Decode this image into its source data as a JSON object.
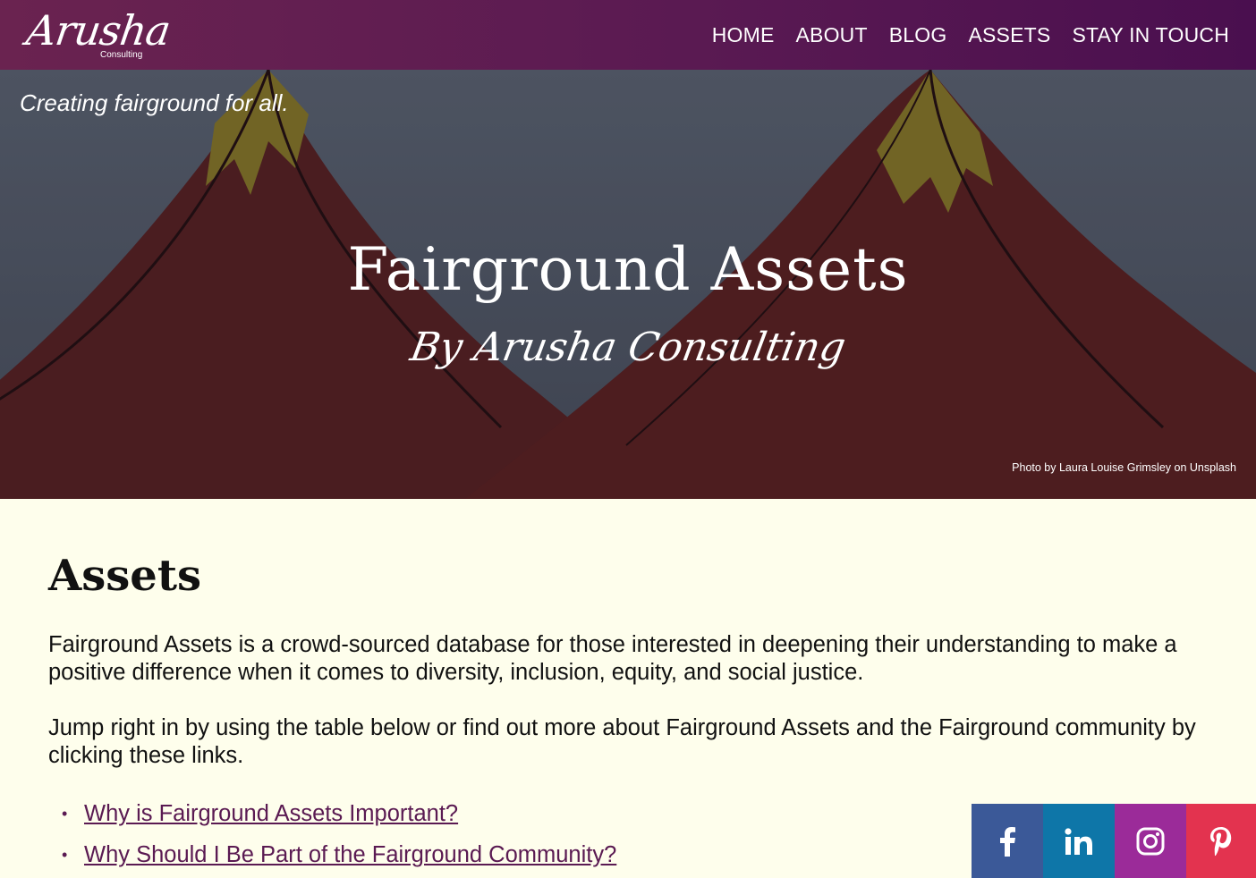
{
  "header": {
    "logo_text": "Arusha",
    "logo_subtext": "Consulting",
    "nav": [
      "HOME",
      "ABOUT",
      "BLOG",
      "ASSETS",
      "STAY IN TOUCH"
    ]
  },
  "hero": {
    "tagline": "Creating fairground for all.",
    "title": "Fairground Assets",
    "subtitle": "By Arusha Consulting",
    "photo_credit": "Photo by Laura Louise Grimsley on Unsplash"
  },
  "content": {
    "heading": "Assets",
    "paragraph1": "Fairground Assets is a crowd-sourced database for those interested in deepening their understanding to make a positive difference when it comes to diversity, inclusion, equity, and social justice.",
    "paragraph2": "Jump right in by using the table below or find out more about Fairground Assets and the Fairground community by clicking these links.",
    "links": [
      "Why is Fairground Assets Important?",
      "Why Should I Be Part of the Fairground Community?"
    ]
  },
  "social": {
    "facebook": "facebook-icon",
    "linkedin": "linkedin-icon",
    "instagram": "instagram-icon",
    "pinterest": "pinterest-icon",
    "colors": {
      "facebook": "#3b5998",
      "linkedin": "#0e76a8",
      "instagram": "#9b2b99",
      "pinterest": "#e3334f"
    }
  },
  "colors": {
    "brand": "#5a1a52",
    "background": "#fefeec"
  }
}
